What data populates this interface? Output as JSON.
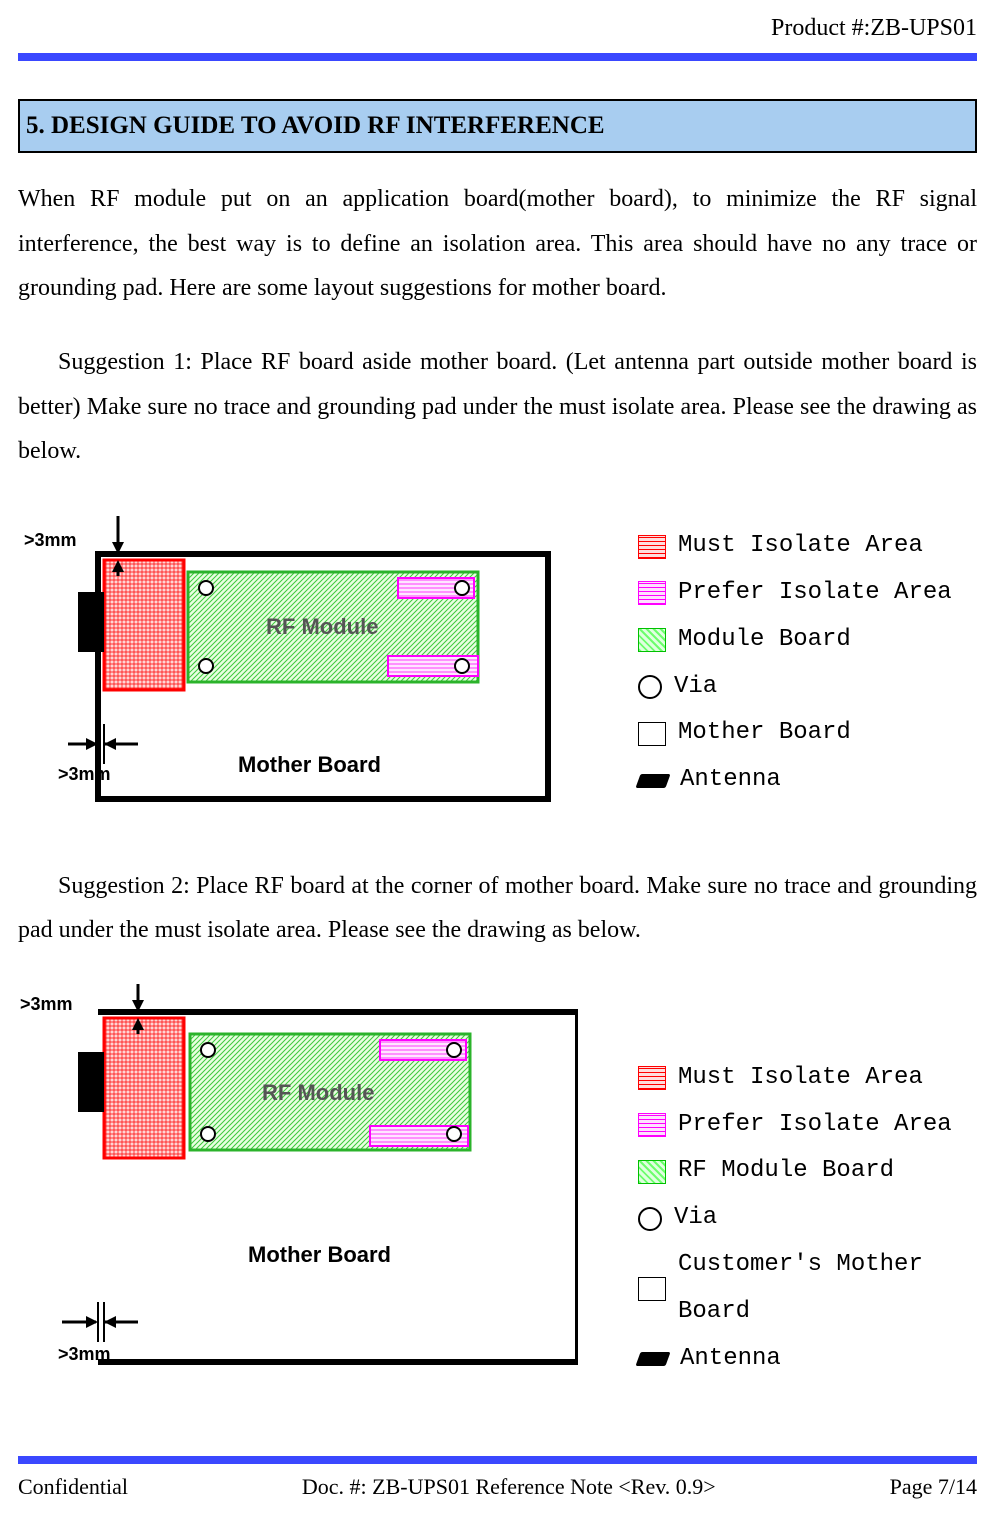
{
  "header": {
    "product": "Product #:ZB-UPS01"
  },
  "section_title": "5. DESIGN GUIDE TO AVOID RF INTERFERENCE",
  "para1": "When RF module put on an application board(mother board), to minimize the RF signal interference, the best way is to define an isolation area. This area should have no any trace or grounding pad. Here are some layout suggestions for mother board.",
  "sugg1": "Suggestion 1: Place RF board aside mother board. (Let antenna part outside mother board is better) Make sure no trace and grounding pad under the must isolate area. Please see the drawing as below.",
  "sugg2": "Suggestion 2: Place RF board at the corner of mother board. Make sure no trace and grounding pad under the must isolate area. Please see the drawing as below.",
  "legend1": {
    "l1": "Must Isolate Area",
    "l2": "Prefer Isolate Area",
    "l3": "Module Board",
    "l4": "Via",
    "l5": "Mother Board",
    "l6": "Antenna"
  },
  "legend2": {
    "l1": "Must Isolate Area",
    "l2": "Prefer Isolate Area",
    "l3": "RF Module Board",
    "l4": "Via",
    "l5": "Customer's Mother Board",
    "l6": "Antenna"
  },
  "diagram": {
    "dim_top": ">3mm",
    "dim_side": ">3mm",
    "mother_board": "Mother Board",
    "rf_module": "RF Module"
  },
  "footer": {
    "left": "Confidential",
    "center": "Doc. #: ZB-UPS01 Reference Note <Rev. 0.9>",
    "right": "Page 7/14"
  }
}
